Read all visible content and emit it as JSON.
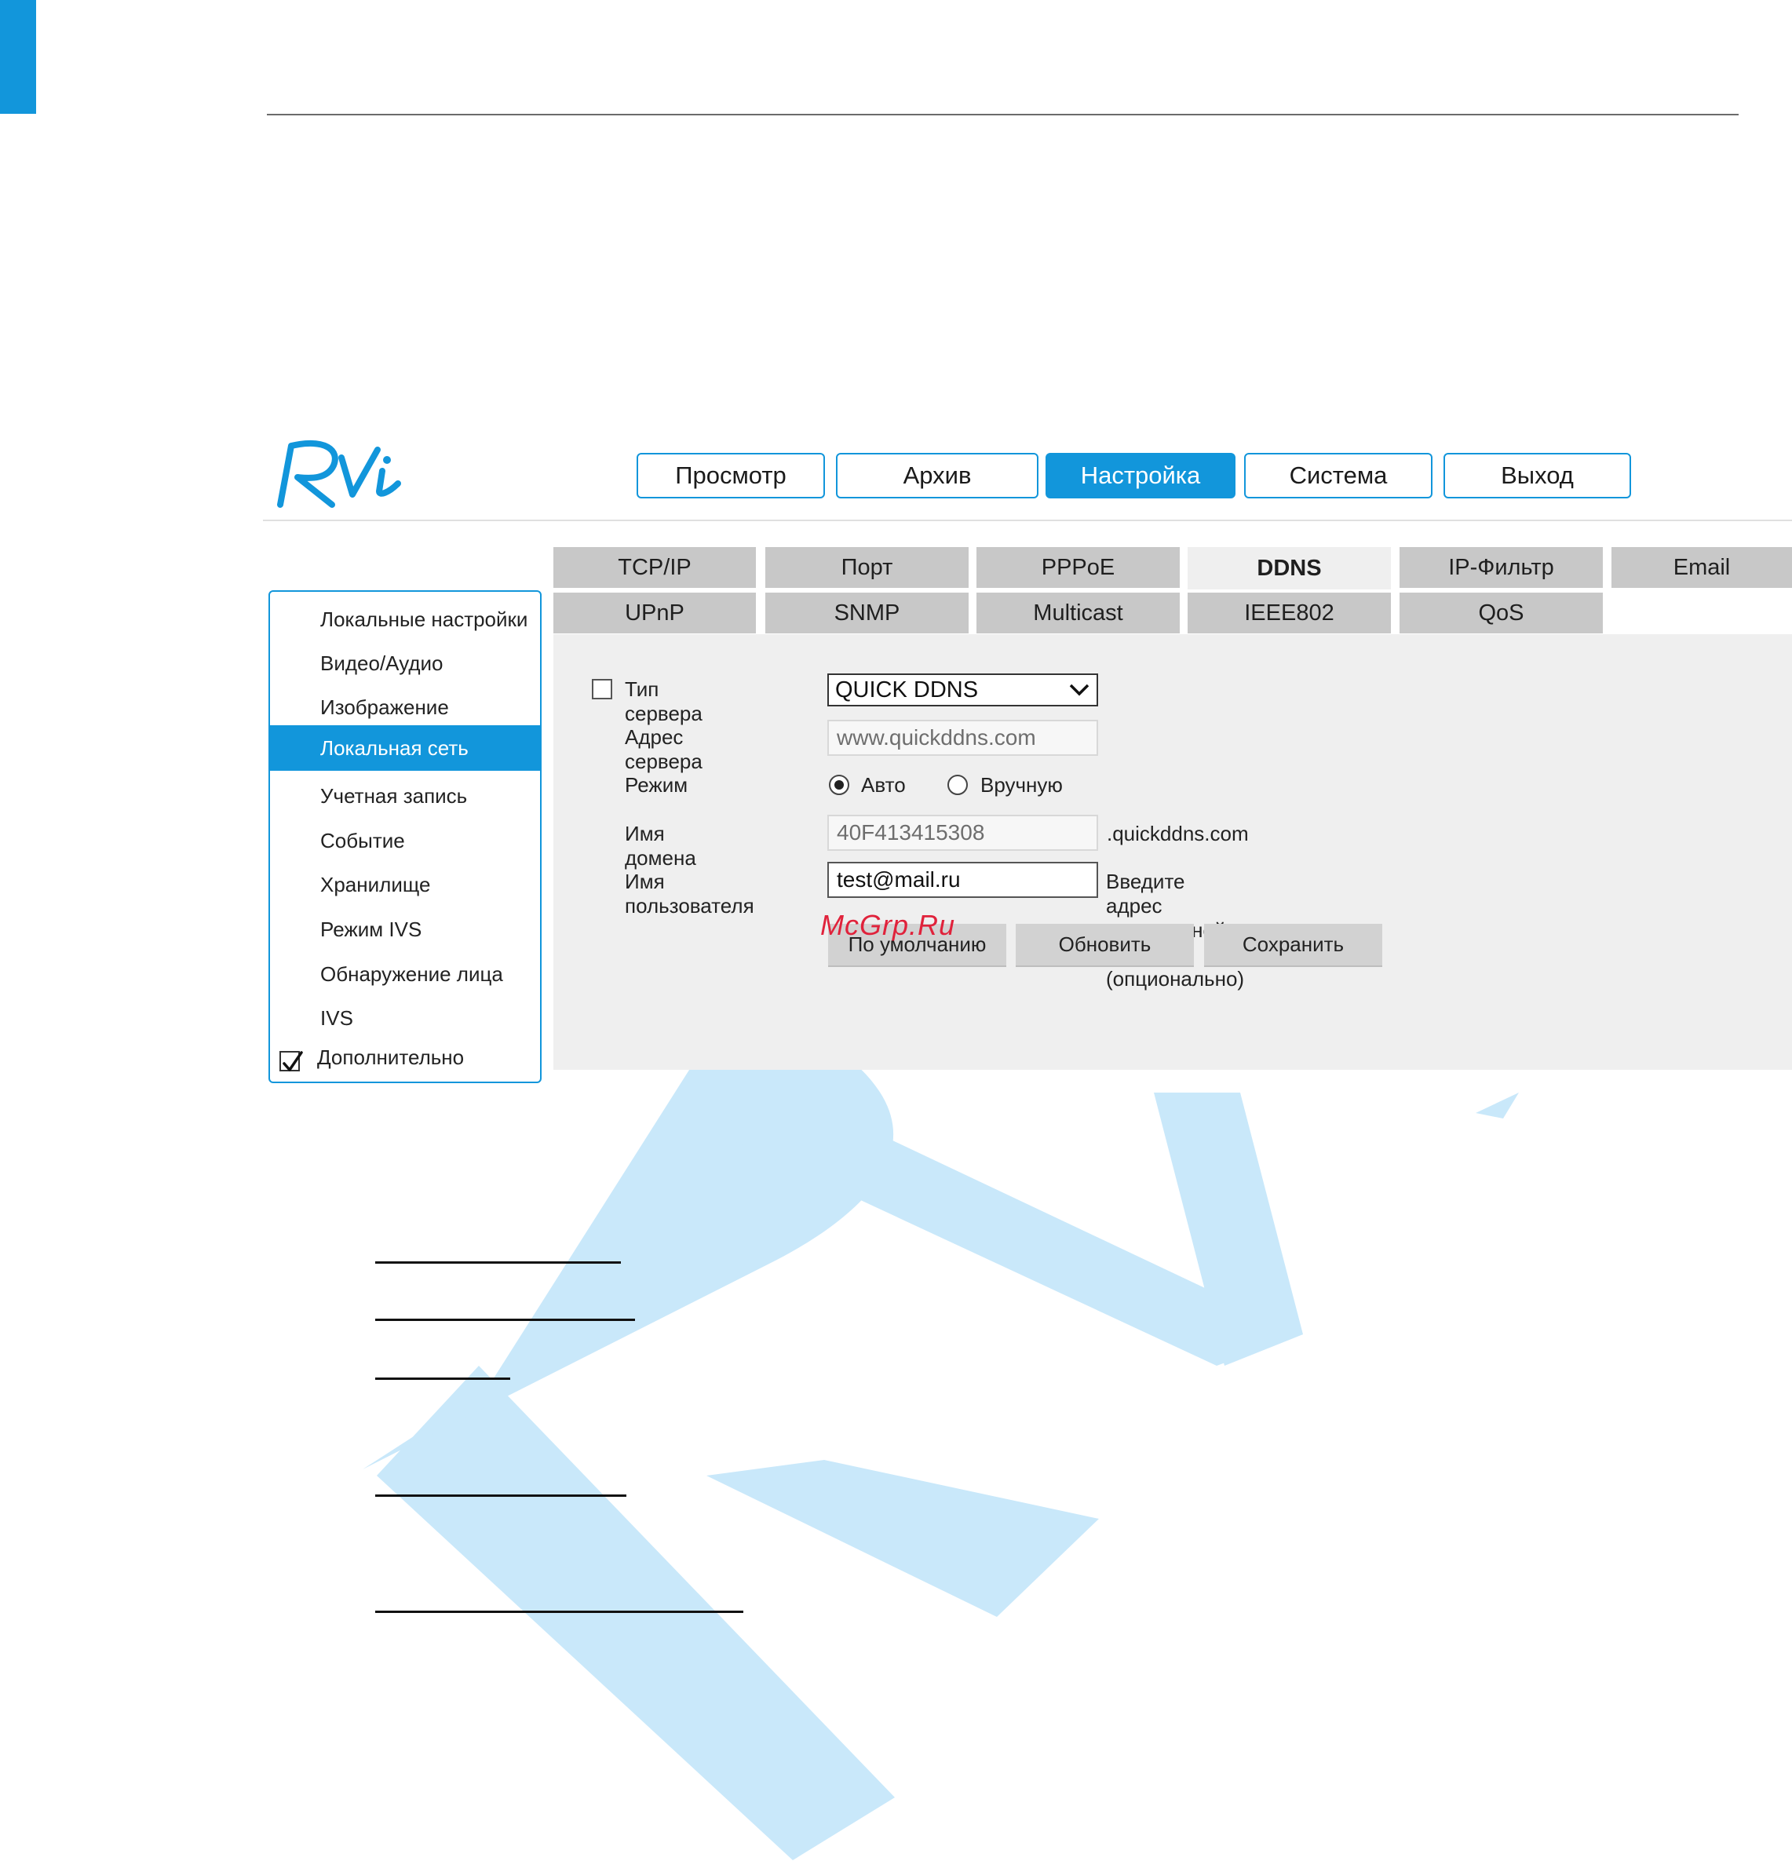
{
  "colors": {
    "accent": "#1296db",
    "tab_bg": "#c8c8c8",
    "panel_bg": "#efefef",
    "watermark": "#c9e8fa",
    "stamp": "#e0223b"
  },
  "logo": {
    "text": "RVi"
  },
  "nav": {
    "items": [
      {
        "label": "Просмотр",
        "active": false
      },
      {
        "label": "Архив",
        "active": false
      },
      {
        "label": "Настройка",
        "active": true
      },
      {
        "label": "Система",
        "active": false
      },
      {
        "label": "Выход",
        "active": false
      }
    ]
  },
  "tabs": {
    "row1": [
      "TCP/IP",
      "Порт",
      "PPPoE",
      "DDNS",
      "IP-Фильтр",
      "Email"
    ],
    "row2": [
      "UPnP",
      "SNMP",
      "Multicast",
      "IEEE802",
      "QoS"
    ],
    "active": "DDNS"
  },
  "sidebar": {
    "items": [
      "Локальные настройки",
      "Видео/Аудио",
      "Изображение",
      "Локальная сеть",
      "Учетная запись",
      "Событие",
      "Хранилище",
      "Режим IVS",
      "Обнаружение лица",
      "IVS"
    ],
    "active_index": 3,
    "extra_label": "Дополнительно",
    "extra_checked": true
  },
  "form": {
    "server_type_label": "Тип сервера",
    "server_type_checked": false,
    "server_type_value": "QUICK DDNS",
    "server_address_label": "Адрес сервера",
    "server_address_value": "www.quickddns.com",
    "mode_label": "Режим",
    "mode_auto": "Авто",
    "mode_manual": "Вручную",
    "mode_selected": "Авто",
    "domain_label": "Имя домена",
    "domain_value": "40F413415308",
    "domain_suffix": ".quickddns.com",
    "user_label": "Имя пользователя",
    "user_value": "test@mail.ru",
    "user_hint": "Введите адрес электронной почты (опционально)"
  },
  "buttons": {
    "default": "По умолчанию",
    "refresh": "Обновить",
    "save": "Сохранить"
  },
  "stamp": "McGrp.Ru"
}
